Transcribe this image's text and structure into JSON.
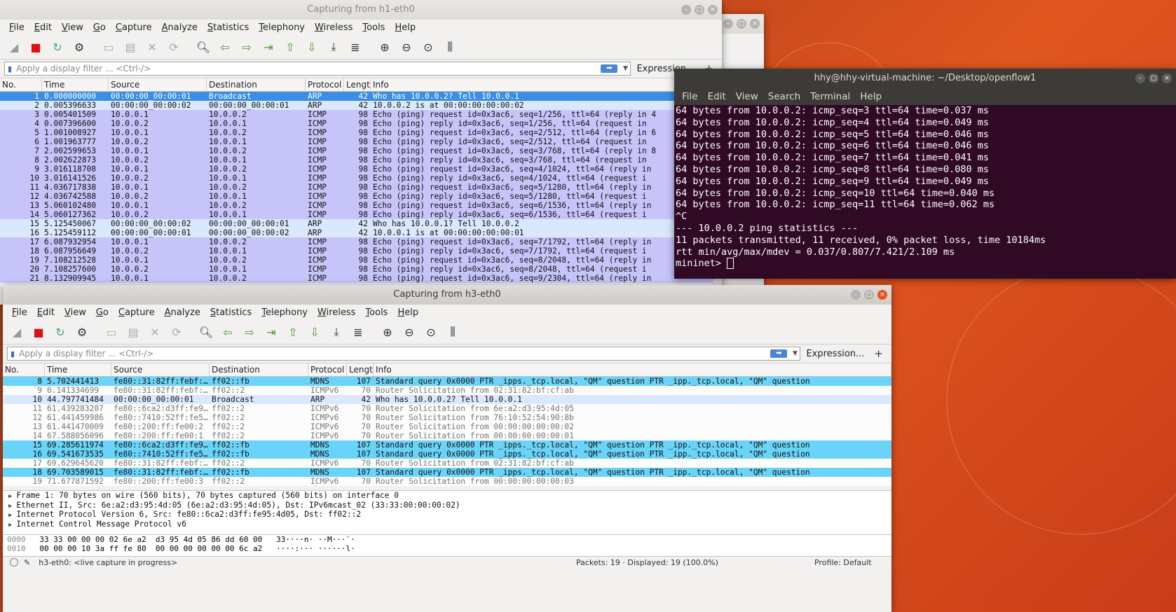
{
  "win1": {
    "title": "Capturing from h1-eth0"
  },
  "win2": {
    "title": "Capturing from h3-eth0"
  },
  "menu": [
    "File",
    "Edit",
    "View",
    "Go",
    "Capture",
    "Analyze",
    "Statistics",
    "Telephony",
    "Wireless",
    "Tools",
    "Help"
  ],
  "filter": {
    "placeholder": "Apply a display filter ... <Ctrl-/>",
    "expression": "Expression...",
    "plus": "+"
  },
  "columns": [
    "No.",
    "Time",
    "Source",
    "Destination",
    "Protocol",
    "Length",
    "Info"
  ],
  "packets1": [
    {
      "no": "1",
      "time": "0.000000000",
      "src": "00:00:00_00:00:01",
      "dst": "Broadcast",
      "proto": "ARP",
      "len": "42",
      "info": "Who has 10.0.0.2? Tell 10.0.0.1",
      "cls": "sel"
    },
    {
      "no": "2",
      "time": "0.005396633",
      "src": "00:00:00_00:00:02",
      "dst": "00:00:00_00:00:01",
      "proto": "ARP",
      "len": "42",
      "info": "10.0.0.2 is at 00:00:00:00:00:02",
      "cls": "arp"
    },
    {
      "no": "3",
      "time": "0.005401509",
      "src": "10.0.0.1",
      "dst": "10.0.0.2",
      "proto": "ICMP",
      "len": "98",
      "info": "Echo (ping) request  id=0x3ac6, seq=1/256, ttl=64 (reply in 4",
      "cls": "icmp"
    },
    {
      "no": "4",
      "time": "0.007396600",
      "src": "10.0.0.2",
      "dst": "10.0.0.1",
      "proto": "ICMP",
      "len": "98",
      "info": "Echo (ping) reply    id=0x3ac6, seq=1/256, ttl=64 (request in",
      "cls": "icmp"
    },
    {
      "no": "5",
      "time": "1.001008927",
      "src": "10.0.0.1",
      "dst": "10.0.0.2",
      "proto": "ICMP",
      "len": "98",
      "info": "Echo (ping) request  id=0x3ac6, seq=2/512, ttl=64 (reply in 6",
      "cls": "icmp"
    },
    {
      "no": "6",
      "time": "1.001963777",
      "src": "10.0.0.2",
      "dst": "10.0.0.1",
      "proto": "ICMP",
      "len": "98",
      "info": "Echo (ping) reply    id=0x3ac6, seq=2/512, ttl=64 (request in",
      "cls": "icmp"
    },
    {
      "no": "7",
      "time": "2.002599653",
      "src": "10.0.0.1",
      "dst": "10.0.0.2",
      "proto": "ICMP",
      "len": "98",
      "info": "Echo (ping) request  id=0x3ac6, seq=3/768, ttl=64 (reply in 8",
      "cls": "icmp"
    },
    {
      "no": "8",
      "time": "2.002622873",
      "src": "10.0.0.2",
      "dst": "10.0.0.1",
      "proto": "ICMP",
      "len": "98",
      "info": "Echo (ping) reply    id=0x3ac6, seq=3/768, ttl=64 (request in",
      "cls": "icmp"
    },
    {
      "no": "9",
      "time": "3.016118708",
      "src": "10.0.0.1",
      "dst": "10.0.0.2",
      "proto": "ICMP",
      "len": "98",
      "info": "Echo (ping) request  id=0x3ac6, seq=4/1024, ttl=64 (reply in",
      "cls": "icmp"
    },
    {
      "no": "10",
      "time": "3.016141526",
      "src": "10.0.0.2",
      "dst": "10.0.0.1",
      "proto": "ICMP",
      "len": "98",
      "info": "Echo (ping) reply    id=0x3ac6, seq=4/1024, ttl=64 (request i",
      "cls": "icmp"
    },
    {
      "no": "11",
      "time": "4.036717838",
      "src": "10.0.0.1",
      "dst": "10.0.0.2",
      "proto": "ICMP",
      "len": "98",
      "info": "Echo (ping) request  id=0x3ac6, seq=5/1280, ttl=64 (reply in",
      "cls": "icmp"
    },
    {
      "no": "12",
      "time": "4.036742588",
      "src": "10.0.0.2",
      "dst": "10.0.0.1",
      "proto": "ICMP",
      "len": "98",
      "info": "Echo (ping) reply    id=0x3ac6, seq=5/1280, ttl=64 (request i",
      "cls": "icmp"
    },
    {
      "no": "13",
      "time": "5.060102480",
      "src": "10.0.0.1",
      "dst": "10.0.0.2",
      "proto": "ICMP",
      "len": "98",
      "info": "Echo (ping) request  id=0x3ac6, seq=6/1536, ttl=64 (reply in",
      "cls": "icmp"
    },
    {
      "no": "14",
      "time": "5.060127362",
      "src": "10.0.0.2",
      "dst": "10.0.0.1",
      "proto": "ICMP",
      "len": "98",
      "info": "Echo (ping) reply    id=0x3ac6, seq=6/1536, ttl=64 (request i",
      "cls": "icmp"
    },
    {
      "no": "15",
      "time": "5.125450067",
      "src": "00:00:00_00:00:02",
      "dst": "00:00:00_00:00:01",
      "proto": "ARP",
      "len": "42",
      "info": "Who has 10.0.0.1? Tell 10.0.0.2",
      "cls": "arp"
    },
    {
      "no": "16",
      "time": "5.125459112",
      "src": "00:00:00_00:00:01",
      "dst": "00:00:00_00:00:02",
      "proto": "ARP",
      "len": "42",
      "info": "10.0.0.1 is at 00:00:00:00:00:01",
      "cls": "arp"
    },
    {
      "no": "17",
      "time": "6.087932954",
      "src": "10.0.0.1",
      "dst": "10.0.0.2",
      "proto": "ICMP",
      "len": "98",
      "info": "Echo (ping) request  id=0x3ac6, seq=7/1792, ttl=64 (reply in",
      "cls": "icmp"
    },
    {
      "no": "18",
      "time": "6.087956649",
      "src": "10.0.0.2",
      "dst": "10.0.0.1",
      "proto": "ICMP",
      "len": "98",
      "info": "Echo (ping) reply    id=0x3ac6, seq=7/1792, ttl=64 (request i",
      "cls": "icmp"
    },
    {
      "no": "19",
      "time": "7.108212528",
      "src": "10.0.0.1",
      "dst": "10.0.0.2",
      "proto": "ICMP",
      "len": "98",
      "info": "Echo (ping) request  id=0x3ac6, seq=8/2048, ttl=64 (reply in",
      "cls": "icmp"
    },
    {
      "no": "20",
      "time": "7.108257600",
      "src": "10.0.0.2",
      "dst": "10.0.0.1",
      "proto": "ICMP",
      "len": "98",
      "info": "Echo (ping) reply    id=0x3ac6, seq=8/2048, ttl=64 (request i",
      "cls": "icmp"
    },
    {
      "no": "21",
      "time": "8.132909945",
      "src": "10.0.0.1",
      "dst": "10.0.0.2",
      "proto": "ICMP",
      "len": "98",
      "info": "Echo (ping) request  id=0x3ac6, seq=9/2304, ttl=64 (reply in",
      "cls": "icmp"
    }
  ],
  "packets2": [
    {
      "no": "8",
      "time": "5.702441413",
      "src": "fe80::31:82ff:febf:…",
      "dst": "ff02::fb",
      "proto": "MDNS",
      "len": "107",
      "info": "Standard query 0x0000 PTR _ipps._tcp.local, \"QM\" question PTR _ipp._tcp.local, \"QM\" question",
      "cls": "mdns"
    },
    {
      "no": "9",
      "time": "6.141334699",
      "src": "fe80::31:82ff:febf:…",
      "dst": "ff02::2",
      "proto": "ICMPv6",
      "len": "70",
      "info": "Router Solicitation from 02:31:82:bf:cf:ab",
      "cls": "icmpv6"
    },
    {
      "no": "10",
      "time": "44.797741484",
      "src": "00:00:00_00:00:01",
      "dst": "Broadcast",
      "proto": "ARP",
      "len": "42",
      "info": "Who has 10.0.0.2? Tell 10.0.0.1",
      "cls": "arp"
    },
    {
      "no": "11",
      "time": "61.439283207",
      "src": "fe80::6ca2:d3ff:fe9…",
      "dst": "ff02::2",
      "proto": "ICMPv6",
      "len": "70",
      "info": "Router Solicitation from 6e:a2:d3:95:4d:05",
      "cls": "icmpv6"
    },
    {
      "no": "12",
      "time": "61.441459986",
      "src": "fe80::7410:52ff:fe5…",
      "dst": "ff02::2",
      "proto": "ICMPv6",
      "len": "70",
      "info": "Router Solicitation from 76:10:52:54:90:8b",
      "cls": "icmpv6"
    },
    {
      "no": "13",
      "time": "61.441470009",
      "src": "fe80::200:ff:fe00:2",
      "dst": "ff02::2",
      "proto": "ICMPv6",
      "len": "70",
      "info": "Router Solicitation from 00:00:00:00:00:02",
      "cls": "icmpv6"
    },
    {
      "no": "14",
      "time": "67.588056096",
      "src": "fe80::200:ff:fe00:1",
      "dst": "ff02::2",
      "proto": "ICMPv6",
      "len": "70",
      "info": "Router Solicitation from 00:00:00:00:00:01",
      "cls": "icmpv6"
    },
    {
      "no": "15",
      "time": "69.285611974",
      "src": "fe80::6ca2:d3ff:fe9…",
      "dst": "ff02::fb",
      "proto": "MDNS",
      "len": "107",
      "info": "Standard query 0x0000 PTR _ipps._tcp.local, \"QM\" question PTR _ipp._tcp.local, \"QM\" question",
      "cls": "mdns"
    },
    {
      "no": "16",
      "time": "69.541673535",
      "src": "fe80::7410:52ff:fe5…",
      "dst": "ff02::fb",
      "proto": "MDNS",
      "len": "107",
      "info": "Standard query 0x0000 PTR _ipps._tcp.local, \"QM\" question PTR _ipp._tcp.local, \"QM\" question",
      "cls": "mdns"
    },
    {
      "no": "17",
      "time": "69.629645620",
      "src": "fe80::31:82ff:febf:…",
      "dst": "ff02::2",
      "proto": "ICMPv6",
      "len": "70",
      "info": "Router Solicitation from 02:31:82:bf:cf:ab",
      "cls": "icmpv6"
    },
    {
      "no": "18",
      "time": "69.703589015",
      "src": "fe80::31:82ff:febf:…",
      "dst": "ff02::fb",
      "proto": "MDNS",
      "len": "107",
      "info": "Standard query 0x0000 PTR _ipps._tcp.local, \"QM\" question PTR _ipp._tcp.local, \"QM\" question",
      "cls": "mdns"
    },
    {
      "no": "19",
      "time": "71.677871592",
      "src": "fe80::200:ff:fe00:3",
      "dst": "ff02::2",
      "proto": "ICMPv6",
      "len": "70",
      "info": "Router Solicitation from 00:00:00:00:00:03",
      "cls": "icmpv6"
    }
  ],
  "details": [
    "Frame 1: 70 bytes on wire (560 bits), 70 bytes captured (560 bits) on interface 0",
    "Ethernet II, Src: 6e:a2:d3:95:4d:05 (6e:a2:d3:95:4d:05), Dst: IPv6mcast_02 (33:33:00:00:00:02)",
    "Internet Protocol Version 6, Src: fe80::6ca2:d3ff:fe95:4d05, Dst: ff02::2",
    "Internet Control Message Protocol v6"
  ],
  "hex": [
    {
      "off": "0000",
      "bytes": "33 33 00 00 00 02 6e a2  d3 95 4d 05 86 dd 60 00",
      "ascii": "33····n· ··M···`·"
    },
    {
      "off": "0010",
      "bytes": "00 00 00 10 3a ff fe 80  00 00 00 00 00 00 6c a2",
      "ascii": "····:··· ······l·"
    }
  ],
  "status": {
    "iface": "h3-eth0: <live capture in progress>",
    "packets": "Packets: 19 · Displayed: 19 (100.0%)",
    "profile": "Profile: Default"
  },
  "terminal": {
    "title": "hhy@hhy-virtual-machine: ~/Desktop/openflow1",
    "menu": [
      "File",
      "Edit",
      "View",
      "Search",
      "Terminal",
      "Help"
    ],
    "lines": [
      "64 bytes from 10.0.0.2: icmp_seq=3 ttl=64 time=0.037 ms",
      "64 bytes from 10.0.0.2: icmp_seq=4 ttl=64 time=0.049 ms",
      "64 bytes from 10.0.0.2: icmp_seq=5 ttl=64 time=0.046 ms",
      "64 bytes from 10.0.0.2: icmp_seq=6 ttl=64 time=0.046 ms",
      "64 bytes from 10.0.0.2: icmp_seq=7 ttl=64 time=0.041 ms",
      "64 bytes from 10.0.0.2: icmp_seq=8 ttl=64 time=0.080 ms",
      "64 bytes from 10.0.0.2: icmp_seq=9 ttl=64 time=0.049 ms",
      "64 bytes from 10.0.0.2: icmp_seq=10 ttl=64 time=0.040 ms",
      "64 bytes from 10.0.0.2: icmp_seq=11 ttl=64 time=0.062 ms",
      "^C",
      "--- 10.0.0.2 ping statistics ---",
      "11 packets transmitted, 11 received, 0% packet loss, time 10184ms",
      "rtt min/avg/max/mdev = 0.037/0.807/7.421/2.109 ms"
    ],
    "prompt": "mininet> "
  },
  "colors": {
    "selected": "#3a8ee6",
    "arp": "#dae8fb",
    "icmp": "#c7c4fa",
    "mdns": "#6ad4f8",
    "terminal_bg": "#300a24"
  }
}
